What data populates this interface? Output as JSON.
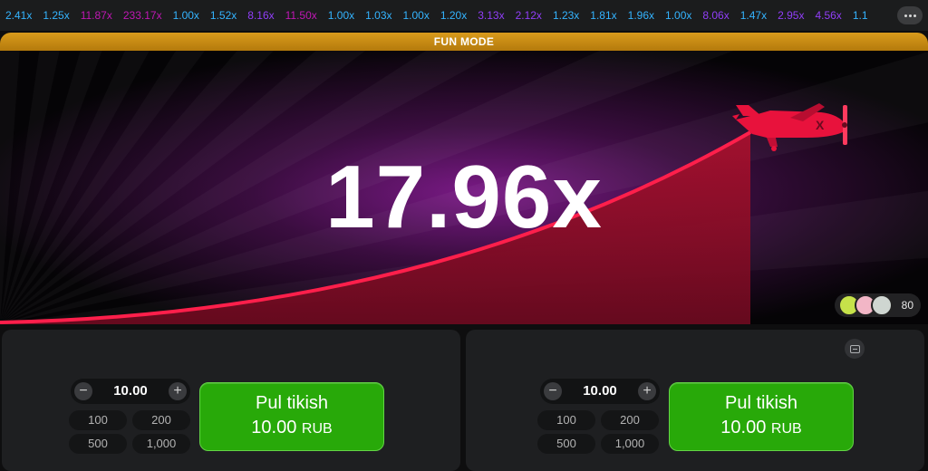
{
  "history": {
    "multipliers": [
      {
        "value": "2.41x",
        "color": "#34b4ff"
      },
      {
        "value": "1.25x",
        "color": "#34b4ff"
      },
      {
        "value": "11.87x",
        "color": "#c017b4"
      },
      {
        "value": "233.17x",
        "color": "#c017b4"
      },
      {
        "value": "1.00x",
        "color": "#34b4ff"
      },
      {
        "value": "1.52x",
        "color": "#34b4ff"
      },
      {
        "value": "8.16x",
        "color": "#913ef8"
      },
      {
        "value": "11.50x",
        "color": "#c017b4"
      },
      {
        "value": "1.00x",
        "color": "#34b4ff"
      },
      {
        "value": "1.03x",
        "color": "#34b4ff"
      },
      {
        "value": "1.00x",
        "color": "#34b4ff"
      },
      {
        "value": "1.20x",
        "color": "#34b4ff"
      },
      {
        "value": "3.13x",
        "color": "#913ef8"
      },
      {
        "value": "2.12x",
        "color": "#913ef8"
      },
      {
        "value": "1.23x",
        "color": "#34b4ff"
      },
      {
        "value": "1.81x",
        "color": "#34b4ff"
      },
      {
        "value": "1.96x",
        "color": "#34b4ff"
      },
      {
        "value": "1.00x",
        "color": "#34b4ff"
      },
      {
        "value": "8.06x",
        "color": "#913ef8"
      },
      {
        "value": "1.47x",
        "color": "#34b4ff"
      },
      {
        "value": "2.95x",
        "color": "#913ef8"
      },
      {
        "value": "4.56x",
        "color": "#913ef8"
      },
      {
        "value": "1.1",
        "color": "#34b4ff"
      }
    ],
    "more_icon": "ellipsis-icon"
  },
  "game": {
    "mode_label": "FUN MODE",
    "current_multiplier": "17.96x",
    "plane_icon": "plane-icon",
    "players_count": "80"
  },
  "bet_panels": [
    {
      "amount": "10.00",
      "quick_amounts": [
        "100",
        "200",
        "500",
        "1,000"
      ],
      "button_title": "Pul tikish",
      "button_amount": "10.00",
      "currency": "RUB"
    },
    {
      "amount": "10.00",
      "quick_amounts": [
        "100",
        "200",
        "500",
        "1,000"
      ],
      "button_title": "Pul tikish",
      "button_amount": "10.00",
      "currency": "RUB",
      "toggle_icon": "minimize-panel-icon"
    }
  ],
  "colors": {
    "accent_green": "#28a909",
    "curve_red": "#e5173f",
    "plane_red": "#e8123c",
    "banner_gold": "#d99b1c"
  }
}
